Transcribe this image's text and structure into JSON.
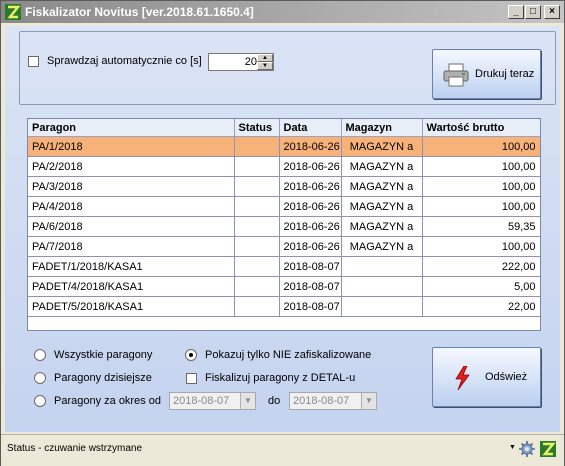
{
  "window": {
    "title": "Fiskalizator Novitus [ver.2018.61.1650.4]",
    "min_label": "_",
    "max_label": "□",
    "close_label": "×"
  },
  "top": {
    "auto_check_label": "Sprawdzaj automatycznie co [s]",
    "auto_check_checked": false,
    "interval_value": "20",
    "print_button_label": "Drukuj teraz"
  },
  "grid": {
    "columns": [
      "Paragon",
      "Status",
      "Data",
      "Magazyn",
      "Wartość brutto"
    ],
    "rows": [
      {
        "paragon": "PA/1/2018",
        "status": "",
        "data": "2018-06-26",
        "magazyn": "MAGAZYN a",
        "wartosc": "100,00"
      },
      {
        "paragon": "PA/2/2018",
        "status": "",
        "data": "2018-06-26",
        "magazyn": "MAGAZYN a",
        "wartosc": "100,00"
      },
      {
        "paragon": "PA/3/2018",
        "status": "",
        "data": "2018-06-26",
        "magazyn": "MAGAZYN a",
        "wartosc": "100,00"
      },
      {
        "paragon": "PA/4/2018",
        "status": "",
        "data": "2018-06-26",
        "magazyn": "MAGAZYN a",
        "wartosc": "100,00"
      },
      {
        "paragon": "PA/6/2018",
        "status": "",
        "data": "2018-06-26",
        "magazyn": "MAGAZYN a",
        "wartosc": "59,35"
      },
      {
        "paragon": "PA/7/2018",
        "status": "",
        "data": "2018-06-26",
        "magazyn": "MAGAZYN a",
        "wartosc": "100,00"
      },
      {
        "paragon": "FADET/1/2018/KASA1",
        "status": "",
        "data": "2018-08-07",
        "magazyn": "",
        "wartosc": "222,00"
      },
      {
        "paragon": "PADET/4/2018/KASA1",
        "status": "",
        "data": "2018-08-07",
        "magazyn": "",
        "wartosc": "5,00"
      },
      {
        "paragon": "PADET/5/2018/KASA1",
        "status": "",
        "data": "2018-08-07",
        "magazyn": "",
        "wartosc": "22,00"
      }
    ],
    "selected_row": 0,
    "selected_color": "#f7b27a"
  },
  "filters": {
    "all_label": "Wszystkie paragony",
    "today_label": "Paragony dzisiejsze",
    "range_label": "Paragony za okres od",
    "range_to_label": "do",
    "date_from": "2018-08-07",
    "date_to": "2018-08-07",
    "show_not_fiscal_label": "Pokazuj tylko NIE zafiskalizowane",
    "fiscalize_detal_label": "Fiskalizuj paragony z DETAL-u",
    "refresh_button_label": "Odśwież"
  },
  "status": {
    "text": "Status  - czuwanie wstrzymane"
  },
  "icons": {
    "app": "app-logo-icon",
    "printer": "printer-icon",
    "refresh": "lightning-icon",
    "tray_gear": "gear-icon",
    "tray_app": "app-tray-icon"
  }
}
